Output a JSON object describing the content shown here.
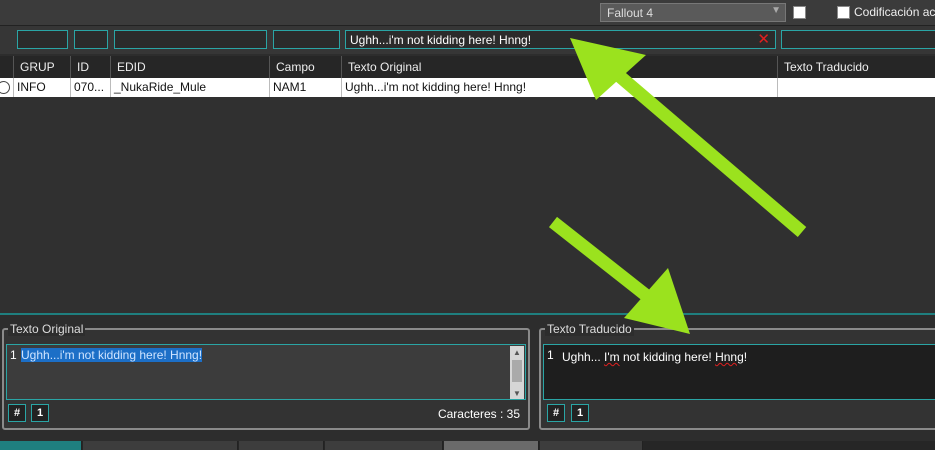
{
  "toolbar": {
    "game_select": "Fallout 4",
    "encoding_label": "Codificación ac"
  },
  "filters": {
    "texto_original": "Ughh...i'm not kidding here!  Hnng!"
  },
  "grid": {
    "columns": [
      "GRUP",
      "ID",
      "EDID",
      "Campo",
      "Texto Original",
      "Texto Traducido"
    ],
    "rows": [
      {
        "grup": "INFO",
        "id": "070...",
        "edid": "_NukaRide_Mule",
        "campo": "NAM1",
        "original": "Ughh...i'm not kidding here!  Hnng!",
        "traducido": ""
      }
    ]
  },
  "panels": {
    "original": {
      "title": "Texto Original",
      "line": "1",
      "text": "Ughh...i'm not kidding here!  Hnng!",
      "hash_btn": "#",
      "pin_btn": "1",
      "counter": "Caracteres : 35"
    },
    "translated": {
      "title": "Texto Traducido",
      "line": "1",
      "text_prefix": "Ughh... ",
      "text_word1": "I'm",
      "text_middle": " not kidding here!  ",
      "text_word2": "Hnng",
      "text_suffix": "!",
      "hash_btn": "#",
      "pin_btn": "1"
    }
  },
  "colors": {
    "accent": "#2aa5a5",
    "arrow": "#9be21e",
    "selection": "#1c6fc7"
  }
}
